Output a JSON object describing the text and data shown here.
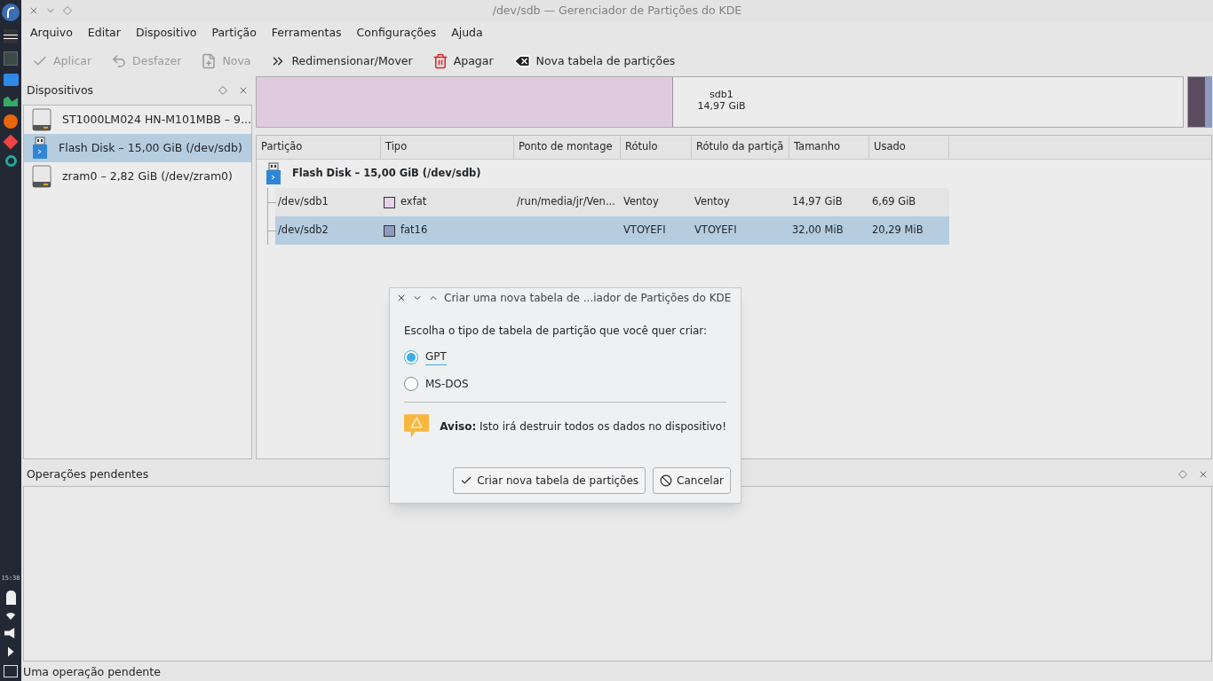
{
  "taskbar": {
    "clock": "15:38"
  },
  "window": {
    "title": "/dev/sdb — Gerenciador de Partições do KDE"
  },
  "menu": [
    "Arquivo",
    "Editar",
    "Dispositivo",
    "Partição",
    "Ferramentas",
    "Configurações",
    "Ajuda"
  ],
  "toolbar": [
    {
      "kind": "check",
      "label": "Aplicar",
      "disabled": true
    },
    {
      "kind": "undo",
      "label": "Desfazer",
      "disabled": true
    },
    {
      "kind": "new",
      "label": "Nova",
      "disabled": true
    },
    {
      "kind": "resize",
      "label": "Redimensionar/Mover",
      "disabled": false
    },
    {
      "kind": "delete",
      "label": "Apagar",
      "disabled": false
    },
    {
      "kind": "table",
      "label": "Nova tabela de partições",
      "disabled": false
    }
  ],
  "devices_panel": {
    "title": "Dispositivos",
    "items": [
      {
        "kind": "hdd",
        "label": "ST1000LM024 HN-M101MBB – 9...",
        "selected": false
      },
      {
        "kind": "usb",
        "label": "Flash Disk – 15,00 GiB (/dev/sdb)",
        "selected": true
      },
      {
        "kind": "hdd",
        "label": "zram0 – 2,82 GiB (/dev/zram0)",
        "selected": false
      }
    ]
  },
  "partition_bar": {
    "segments": [
      {
        "name": "sdb1",
        "size": "14,97 GiB",
        "level": 0.45,
        "color": "#dfcbe0"
      },
      {
        "color": "#5a4c5e"
      }
    ]
  },
  "table": {
    "columns": [
      "Partição",
      "Tipo",
      "Ponto de montage",
      "Rótulo",
      "Rótulo da partiçã",
      "Tamanho",
      "Usado"
    ],
    "device": "Flash Disk – 15,00 GiB (/dev/sdb)",
    "rows": [
      {
        "partition": "/dev/sdb1",
        "color": "#e6d3e6",
        "type": "exfat",
        "mount": "/run/media/jr/Ven...",
        "label": "Ventoy",
        "part_label": "Ventoy",
        "size": "14,97 GiB",
        "used": "6,69 GiB",
        "selected": false
      },
      {
        "partition": "/dev/sdb2",
        "color": "#8e9bbf",
        "type": "fat16",
        "mount": "",
        "label": "VTOYEFI",
        "part_label": "VTOYEFI",
        "size": "32,00 MiB",
        "used": "20,29 MiB",
        "selected": true
      }
    ]
  },
  "pending_panel": {
    "title": "Operações pendentes"
  },
  "status_bar": "Uma operação pendente",
  "dialog": {
    "title": "Criar uma nova tabela de ...iador de Partições do KDE",
    "prompt": "Escolha o tipo de tabela de partição que você quer criar:",
    "options": [
      {
        "label": "GPT",
        "selected": true
      },
      {
        "label": "MS-DOS",
        "selected": false
      }
    ],
    "warning": "**Aviso:** Isto irá destruir todos os dados no dispositivo!",
    "buttons": [
      {
        "kind": "ok",
        "label": "Criar nova tabela de partições"
      },
      {
        "kind": "cancel",
        "label": "Cancelar"
      }
    ]
  }
}
